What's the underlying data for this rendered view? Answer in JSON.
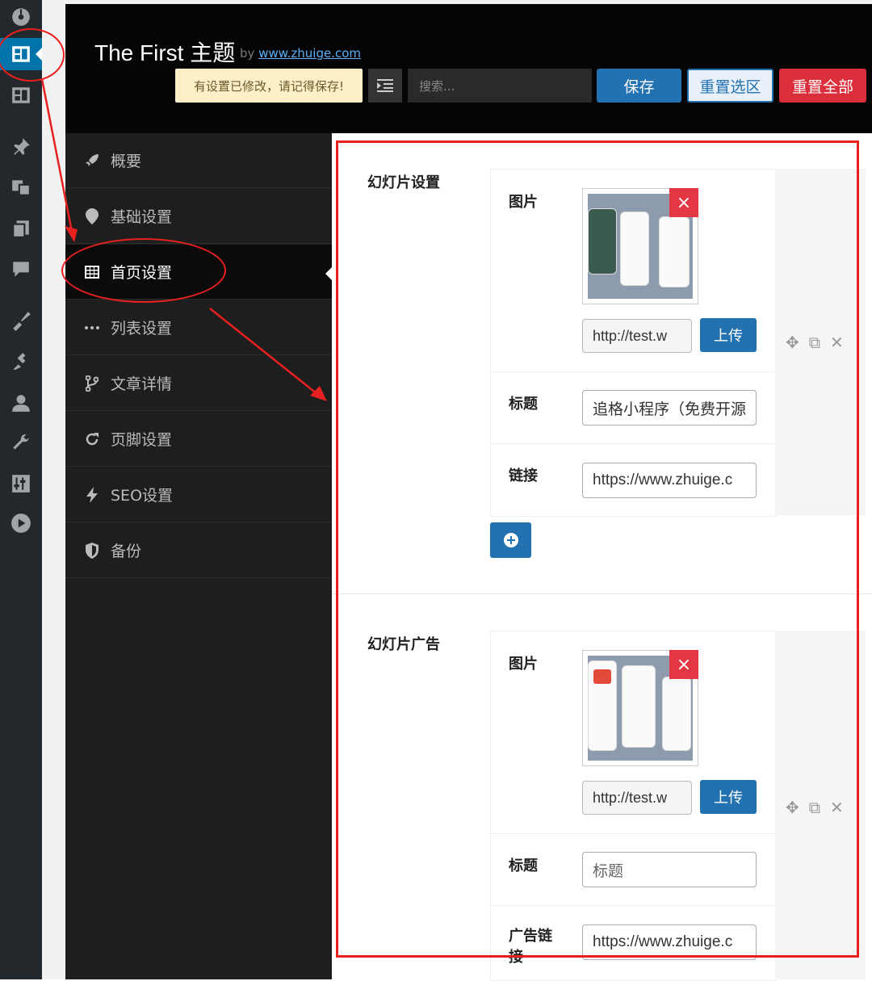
{
  "header": {
    "title": "The First 主题",
    "by": "by",
    "link": "www.zhuige.com",
    "notice": "有设置已修改，请记得保存!",
    "search_placeholder": "搜索...",
    "save": "保存",
    "reset_section": "重置选区",
    "reset_all": "重置全部"
  },
  "nav": {
    "items": [
      {
        "label": "概要",
        "icon": "rocket-icon"
      },
      {
        "label": "基础设置",
        "icon": "map-pin-icon"
      },
      {
        "label": "首页设置",
        "icon": "table-icon"
      },
      {
        "label": "列表设置",
        "icon": "ellipsis-icon"
      },
      {
        "label": "文章详情",
        "icon": "code-branch-icon"
      },
      {
        "label": "页脚设置",
        "icon": "refresh-icon"
      },
      {
        "label": "SEO设置",
        "icon": "bolt-icon"
      },
      {
        "label": "备份",
        "icon": "shield-icon"
      }
    ],
    "active_index": 2
  },
  "slideshow": {
    "title": "幻灯片设置",
    "image_label": "图片",
    "image_url": "http://test.w",
    "upload": "上传",
    "title_label": "标题",
    "title_value": "追格小程序（免费开源",
    "link_label": "链接",
    "link_value": "https://www.zhuige.c"
  },
  "slide_ad": {
    "title": "幻灯片广告",
    "image_label": "图片",
    "image_url": "http://test.w",
    "upload": "上传",
    "title_label": "标题",
    "title_placeholder": "标题",
    "link_label": "广告链接",
    "link_value": "https://www.zhuige.c"
  },
  "colors": {
    "accent": "#2271b1",
    "danger": "#dc2f3c",
    "annotation": "#e82020"
  }
}
